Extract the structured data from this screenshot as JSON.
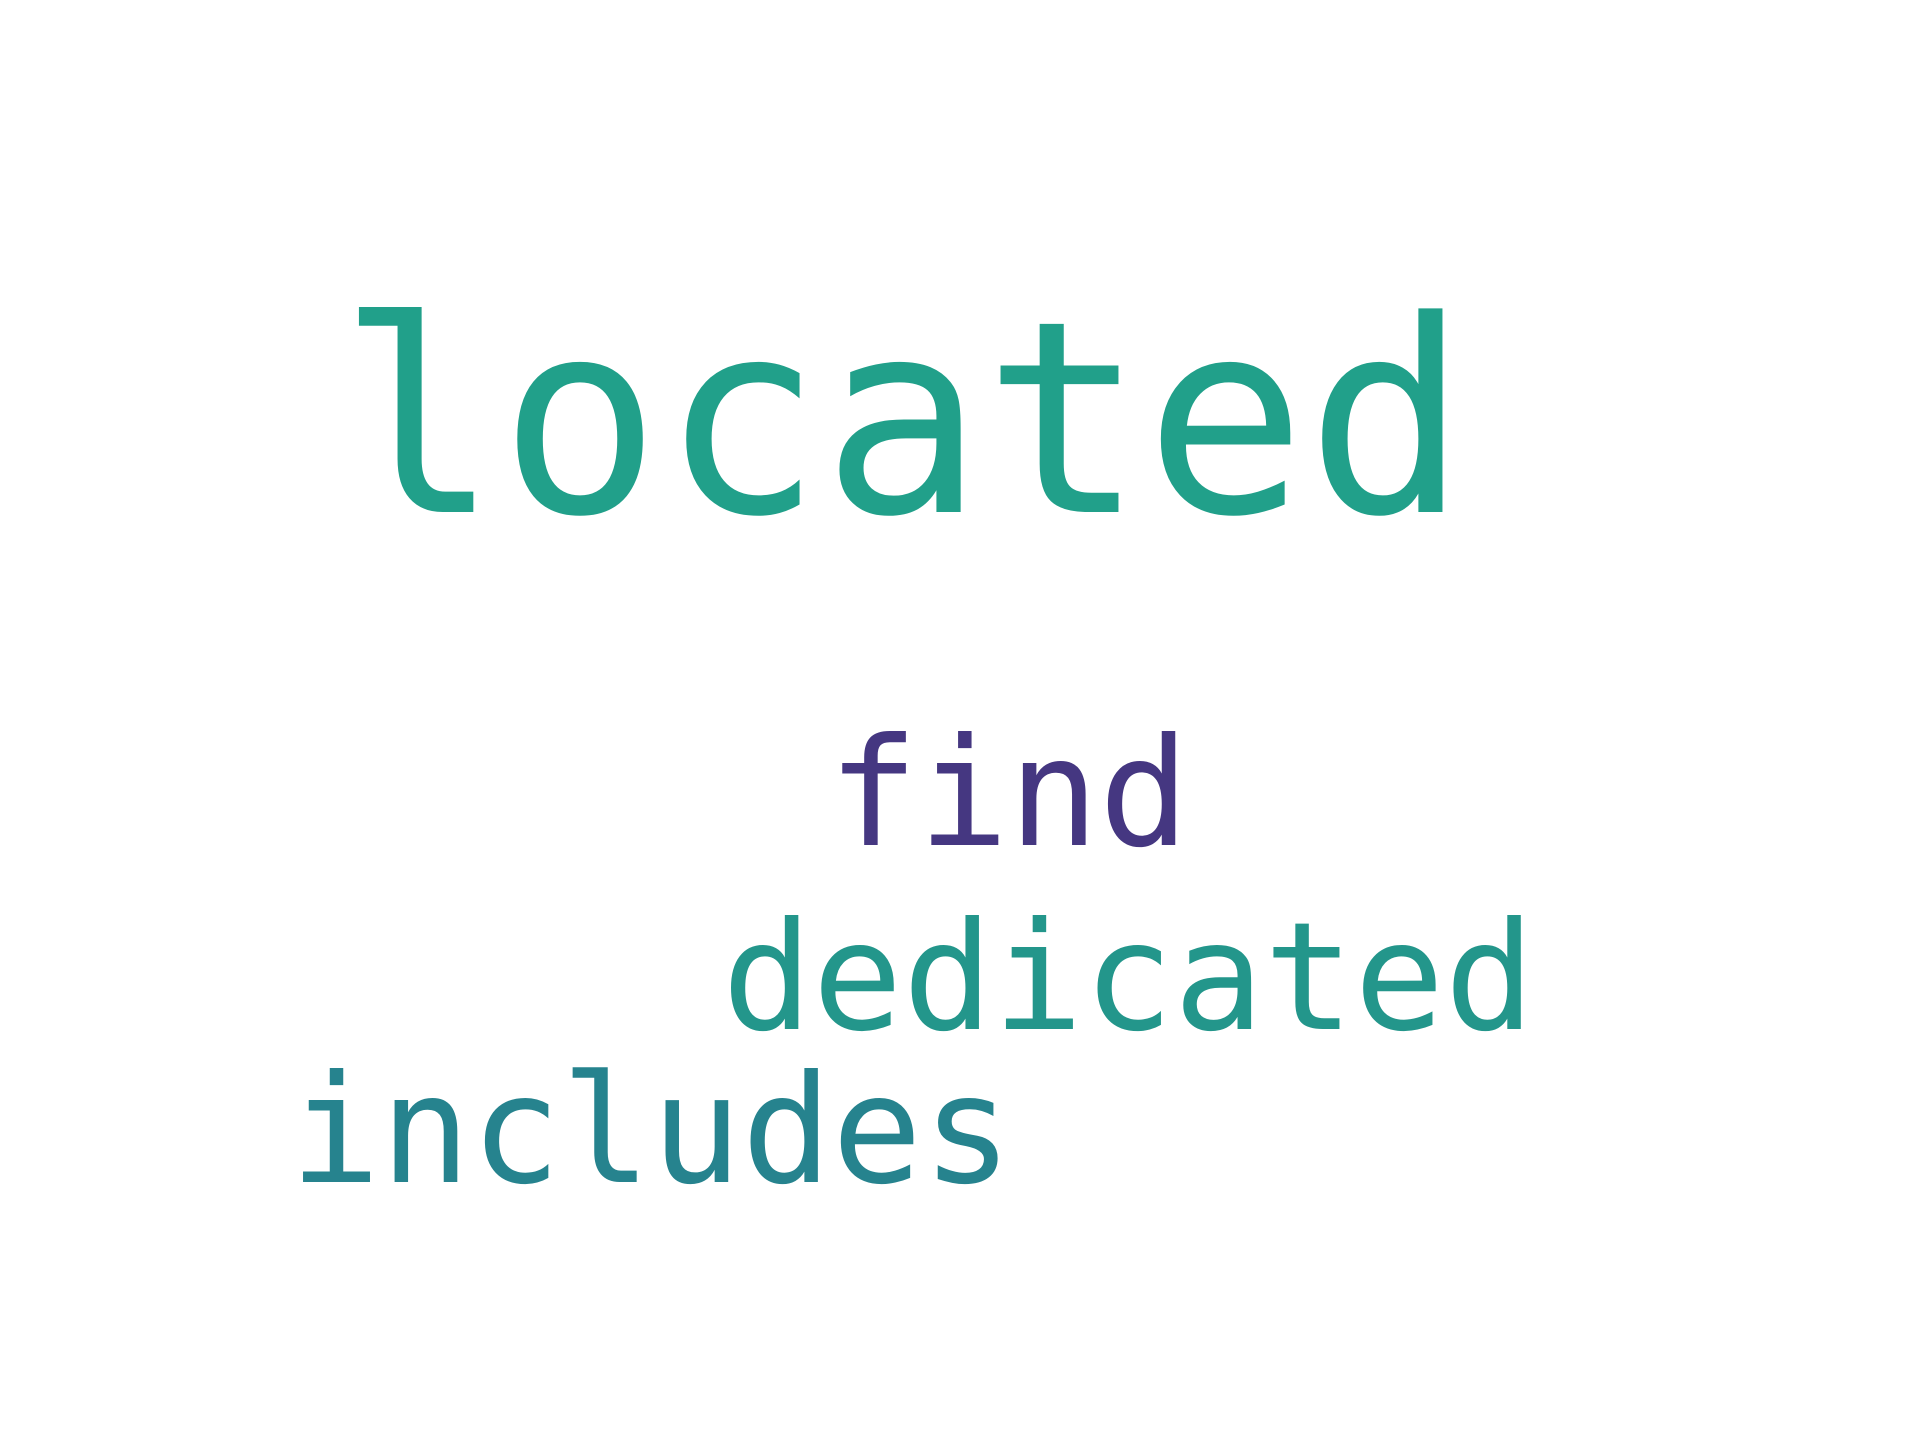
{
  "wordcloud": {
    "words": [
      {
        "text": "located",
        "color": "#21a08a"
      },
      {
        "text": "find",
        "color": "#453781"
      },
      {
        "text": "dedicated",
        "color": "#23968b"
      },
      {
        "text": "includes",
        "color": "#26838e"
      }
    ]
  }
}
